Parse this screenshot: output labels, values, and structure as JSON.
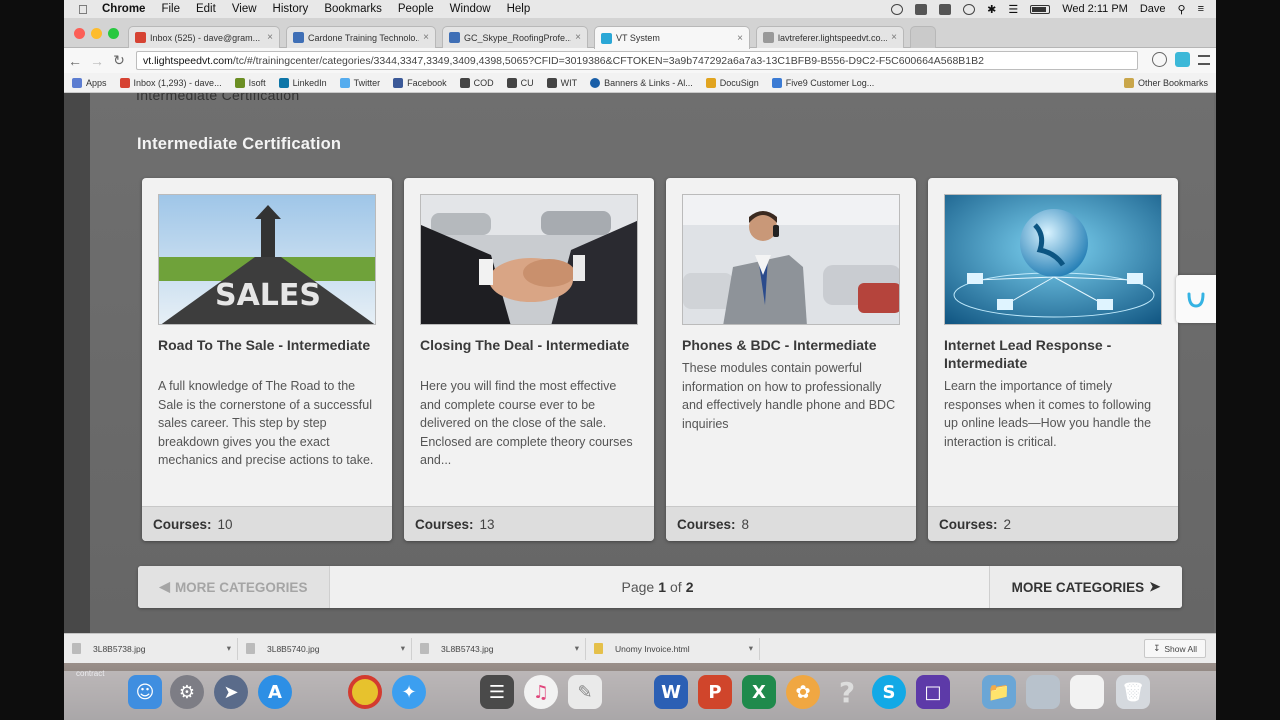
{
  "menubar": {
    "app": "Chrome",
    "items": [
      "File",
      "Edit",
      "View",
      "History",
      "Bookmarks",
      "People",
      "Window",
      "Help"
    ],
    "clock": "Wed 2:11 PM",
    "user": "Dave"
  },
  "tabs": [
    {
      "label": "Inbox (525) - dave@gram...",
      "color": "#d64333"
    },
    {
      "label": "Cardone Training Technolo...",
      "color": "#3f6fb6"
    },
    {
      "label": "GC_Skype_RoofingProfe...",
      "color": "#3f6fb6"
    },
    {
      "label": "VT System",
      "color": "#2aa7d6"
    },
    {
      "label": "lavtreferer.lightspeedvt.co...",
      "color": "#999999"
    }
  ],
  "address": {
    "domain": "vt.lightspeedvt.com",
    "path": "/tc/#/trainingcenter/categories/3344,3347,3349,3409,4398,5065?CFID=3019386&CFTOKEN=3a9b747292a6a7a3-13C1BFB9-B556-D9C2-F5C600664A568B1B2"
  },
  "bookmarks": [
    {
      "label": "Apps",
      "color": "#5c7dd1"
    },
    {
      "label": "Inbox (1,293) - dave...",
      "color": "#d64333"
    },
    {
      "label": "Isoft",
      "color": "#6b8e23"
    },
    {
      "label": "LinkedIn",
      "color": "#0e76a8"
    },
    {
      "label": "Twitter",
      "color": "#55acee"
    },
    {
      "label": "Facebook",
      "color": "#3b5998"
    },
    {
      "label": "COD",
      "color": "#444444"
    },
    {
      "label": "CU",
      "color": "#444444"
    },
    {
      "label": "WIT",
      "color": "#444444"
    },
    {
      "label": "Banners & Links - Al...",
      "color": "#1a5fa8"
    },
    {
      "label": "DocuSign",
      "color": "#e1a41f"
    },
    {
      "label": "Five9 Customer Log...",
      "color": "#3b7bd4"
    }
  ],
  "other_bookmarks": "Other Bookmarks",
  "page": {
    "crumb": "Intermediate Certification",
    "section_title": "Intermediate Certification",
    "cards": [
      {
        "title": "Road To The Sale - Intermediate",
        "description": "A full knowledge of The Road to the Sale is the cornerstone of a successful sales career. This step by step breakdown gives you the exact mechanics and precise actions to take.",
        "courses_label": "Courses:",
        "courses": "10",
        "image": "road-sales-image"
      },
      {
        "title": "Closing The Deal - Intermediate",
        "description": "Here you will find the most effective and complete course ever to be delivered on the close of the sale. Enclosed are complete theory courses and...",
        "courses_label": "Courses:",
        "courses": "13",
        "image": "handshake-image"
      },
      {
        "title": "Phones & BDC - Intermediate",
        "description": "These modules contain powerful information on how to professionally and effectively handle phone and BDC inquiries",
        "courses_label": "Courses:",
        "courses": "8",
        "image": "phone-salesman-image"
      },
      {
        "title": "Internet Lead Response - Intermediate",
        "description": "Learn the importance of timely responses when it comes to following up online leads—How you handle the interaction is critical.",
        "courses_label": "Courses:",
        "courses": "2",
        "image": "globe-network-image"
      }
    ],
    "pager": {
      "prev": "MORE CATEGORIES",
      "page_word": "Page",
      "current": "1",
      "of_word": "of",
      "total": "2",
      "next": "MORE CATEGORIES"
    }
  },
  "downloads": [
    {
      "name": "3L8B5738.jpg"
    },
    {
      "name": "3L8B5740.jpg"
    },
    {
      "name": "3L8B5743.jpg"
    },
    {
      "name": "Unomy Invoice.html"
    }
  ],
  "show_all": "Show All",
  "dock_label": "contract"
}
